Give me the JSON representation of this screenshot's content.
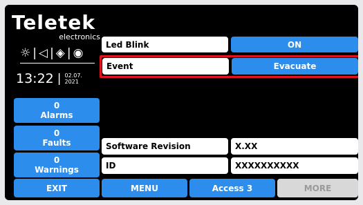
{
  "brand": {
    "name": "Teletek",
    "sub": "electronics"
  },
  "status_icons": [
    "☼",
    "◁",
    "◈",
    "◉"
  ],
  "clock": {
    "time": "13:22",
    "date_line1": "02.07.",
    "date_line2": "2021"
  },
  "counters": {
    "alarms": {
      "count": "0",
      "label": "Alarms"
    },
    "faults": {
      "count": "0",
      "label": "Faults"
    },
    "warnings": {
      "count": "0",
      "label": "Warnings"
    }
  },
  "rows": {
    "led_blink": {
      "label": "Led Blink",
      "value": "ON"
    },
    "event": {
      "label": "Event",
      "value": "Evacuate"
    },
    "software_revision": {
      "label": "Software Revision",
      "value": "X.XX"
    },
    "id": {
      "label": "ID",
      "value": "XXXXXXXXXX"
    }
  },
  "footer": {
    "exit": "EXIT",
    "menu": "MENU",
    "access": "Access 3",
    "more": "MORE"
  },
  "colors": {
    "blue": "#2d8ded",
    "selection": "#e0141e",
    "disabled": "#d8d8d8"
  }
}
